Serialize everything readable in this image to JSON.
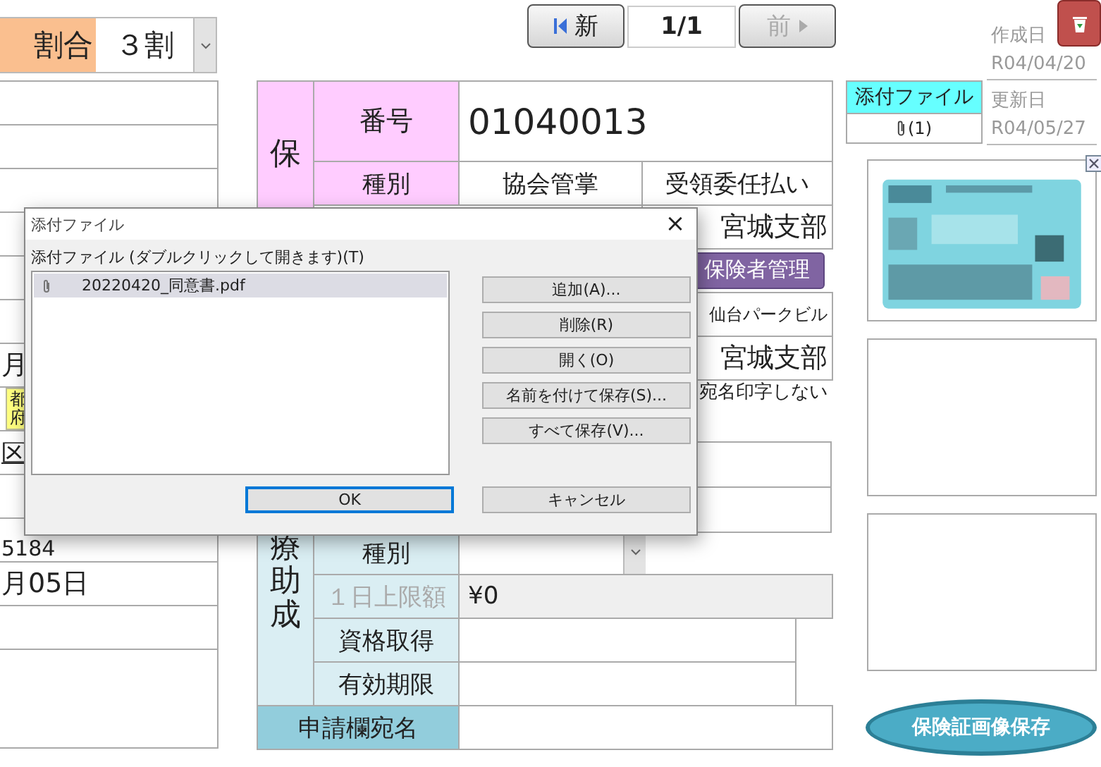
{
  "burden_ratio": {
    "label": "割合",
    "value": "３割"
  },
  "left_fragments": {
    "month": "月",
    "tags": [
      "都",
      "府"
    ],
    "ward": "区",
    "phone": "5184",
    "date": "月05日"
  },
  "navigation": {
    "first_button": "新",
    "record": "1/1",
    "prev_button": {
      "label": "前",
      "disabled": true
    }
  },
  "insurer": {
    "section_label": "保",
    "number_label": "番号",
    "number": "01040013",
    "type_label": "種別",
    "type": "協会管掌",
    "payment": "受領委任払い",
    "branch": "宮城支部",
    "manage_button": "保険者管理",
    "building": "仙台パークビル",
    "branch_2": "宮城支部",
    "no_address_print": "宛名印字しない"
  },
  "subsidy": {
    "section_label": "療助成",
    "rows": [
      {
        "label": "種別",
        "kind": "dropdown",
        "disabled": false
      },
      {
        "label": "１日上限額",
        "value": "¥0",
        "kind": "field",
        "disabled": true
      },
      {
        "label": "資格取得",
        "kind": "field",
        "disabled": false
      },
      {
        "label": "有効期限",
        "kind": "field",
        "disabled": false
      }
    ],
    "addressee_label": "申請欄宛名"
  },
  "record_info": {
    "created_label": "作成日",
    "created": "R04/04/20",
    "updated_label": "更新日",
    "updated": "R04/05/27"
  },
  "attachments": {
    "header": "添付ファイル",
    "count": "(1)"
  },
  "card_images": [
    {
      "kind": "picture"
    },
    {
      "kind": "empty"
    },
    {
      "kind": "empty"
    }
  ],
  "save_image_button": "保険証画像保存",
  "dialog": {
    "title": "添付ファイル",
    "close": "×",
    "list_label": "添付ファイル (ダブルクリックして開きます)(T)",
    "files": [
      {
        "name": "20220420_同意書.pdf",
        "selected": true
      }
    ],
    "buttons": [
      "追加(A)...",
      "削除(R)",
      "開く(O)",
      "名前を付けて保存(S)...",
      "すべて保存(V)..."
    ],
    "ok": "OK",
    "cancel": "キャンセル"
  }
}
